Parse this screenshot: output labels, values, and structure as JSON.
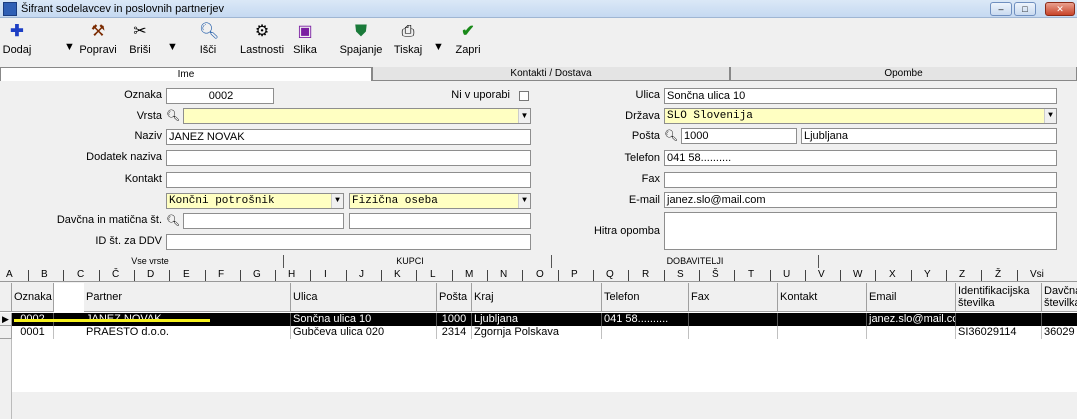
{
  "window": {
    "title": "Šifrant sodelavcev in poslovnih partnerjev"
  },
  "toolbar": {
    "add": "Dodaj",
    "edit": "Popravi",
    "delete": "Briši",
    "search": "Išči",
    "properties": "Lastnosti",
    "image": "Slika",
    "merge": "Spajanje",
    "print": "Tiskaj",
    "close": "Zapri"
  },
  "tabs": [
    "Ime",
    "Kontakti / Dostava",
    "Opombe"
  ],
  "form": {
    "oznaka_label": "Oznaka",
    "oznaka": "0002",
    "ni_v_uporabi_label": "Ni v uporabi",
    "vrsta_label": "Vrsta",
    "vrsta": "",
    "naziv_label": "Naziv",
    "naziv": "JANEZ NOVAK",
    "dodatek_label": "Dodatek naziva",
    "dodatek": "",
    "kontakt_label": "Kontakt",
    "kontakt": "",
    "tip_kupca": "Končni potrošnik",
    "oseba": "Fizična oseba",
    "davcna_label": "Davčna in matična št.",
    "davcna": "",
    "maticna": "",
    "id_ddv_label": "ID št. za DDV",
    "id_ddv": "",
    "ulica_label": "Ulica",
    "ulica": "Sončna ulica 10",
    "drzava_label": "Država",
    "drzava": "SLO  Slovenija",
    "posta_label": "Pošta",
    "posta": "1000",
    "kraj": "Ljubljana",
    "telefon_label": "Telefon",
    "telefon": "041 58..........",
    "fax_label": "Fax",
    "fax": "",
    "email_label": "E-mail",
    "email": "janez.slo@mail.com",
    "opomba_label": "Hitra opomba",
    "opomba": ""
  },
  "list_tabs": [
    "Vse vrste",
    "KUPCI",
    "DOBAVITELJI"
  ],
  "letters": [
    "A",
    "B",
    "C",
    "Č",
    "D",
    "E",
    "F",
    "G",
    "H",
    "I",
    "J",
    "K",
    "L",
    "M",
    "N",
    "O",
    "P",
    "Q",
    "R",
    "S",
    "Š",
    "T",
    "U",
    "V",
    "W",
    "X",
    "Y",
    "Z",
    "Ž",
    "Vsi"
  ],
  "grid": {
    "headers": [
      "Oznaka",
      "Partner",
      "Ulica",
      "Pošta",
      "Kraj",
      "Telefon",
      "Fax",
      "Kontakt",
      "Email",
      "Identifikacijska številka",
      "Davčna številka"
    ],
    "rows": [
      [
        "0002",
        "JANEZ NOVAK",
        "Sončna ulica 10",
        "1000",
        "Ljubljana",
        "041 58..........",
        "",
        "",
        "janez.slo@mail.cc",
        "",
        ""
      ],
      [
        "0001",
        "PRAESTO d.o.o.",
        "Gubčeva ulica 020",
        "2314",
        "Zgornja Polskava",
        "",
        "",
        "",
        "",
        "SI36029114",
        "36029"
      ]
    ]
  },
  "colors": {
    "selected_row": "#000000",
    "highlight": "#f7f21c",
    "yellow_field": "#ffffc2"
  }
}
